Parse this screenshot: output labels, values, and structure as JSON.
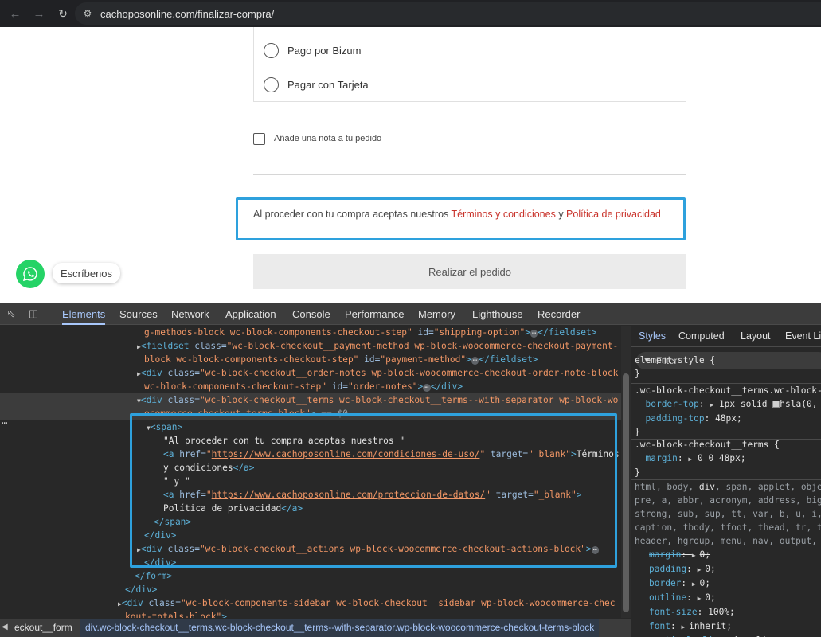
{
  "browser": {
    "url": "cachoposonline.com/finalizar-compra/",
    "back_icon": "arrow-left-icon",
    "forward_icon": "arrow-right-icon",
    "reload_icon": "reload-icon"
  },
  "page": {
    "payment_options": [
      {
        "label": "Pago por Bizum"
      },
      {
        "label": "Pagar con Tarjeta"
      }
    ],
    "note_label": "Añade una nota a tu pedido",
    "terms": {
      "prefix": "Al proceder con tu compra aceptas nuestros ",
      "terms_link": "Términos y condiciones",
      "and": " y ",
      "privacy_link": "Política de privacidad"
    },
    "order_button": "Realizar el pedido",
    "whatsapp_label": "Escríbenos"
  },
  "devtools": {
    "tabs": [
      "Elements",
      "Sources",
      "Network",
      "Application",
      "Console",
      "Performance",
      "Memory",
      "Lighthouse",
      "Recorder"
    ],
    "active_tab": "Elements",
    "dom_lines": {
      "l1": {
        "a": "g-methods-block wc-block-components-checkout-step\"",
        "b": " id=",
        "c": "\"shipping-option\"",
        "d": ">",
        "e": "</fieldset>"
      },
      "l2": {
        "tag": "<fieldset",
        "attr": " class=",
        "val": "\"wc-block-checkout__payment-method wp-block-woocommerce-checkout-payment-"
      },
      "l3": {
        "val": "block wc-block-components-checkout-step\"",
        "attr": " id=",
        "val2": "\"payment-method\"",
        "tag": ">",
        "end": "</fieldset>"
      },
      "l4": {
        "tag": "<div",
        "attr": " class=",
        "val": "\"wc-block-checkout__order-notes wp-block-woocommerce-checkout-order-note-block"
      },
      "l5": {
        "val": "wc-block-components-checkout-step\"",
        "attr": " id=",
        "val2": "\"order-notes\"",
        "tag": ">",
        "end": "</div>"
      },
      "l6": {
        "tag": "<div",
        "attr": " class=",
        "val": "\"wc-block-checkout__terms wc-block-checkout__terms--with-separator wp-block-wo"
      },
      "l7": {
        "val": "ocommerce-checkout-terms-block\"",
        "tag": ">",
        "dim": " == $0"
      },
      "l8": {
        "tag": "<span>"
      },
      "l9": {
        "txt": "\"Al proceder con tu compra aceptas nuestros \""
      },
      "l10": {
        "tag": "<a",
        "attr": " href=",
        "link": "https://www.cachoposonline.com/condiciones-de-uso/",
        "attr2": " target=",
        "val": "\"_blank\"",
        "tag2": ">",
        "txt": "Términos"
      },
      "l11": {
        "txt": "y condiciones",
        "tag": "</a>"
      },
      "l12": {
        "txt": "\" y \""
      },
      "l13": {
        "tag": "<a",
        "attr": " href=",
        "link": "https://www.cachoposonline.com/proteccion-de-datos/",
        "attr2": " target=",
        "val": "\"_blank\"",
        "tag2": ">"
      },
      "l14": {
        "txt": "Política de privacidad",
        "tag": "</a>"
      },
      "l15": {
        "tag": "</span>"
      },
      "l16": {
        "tag": "</div>"
      },
      "l17": {
        "tag": "<div",
        "attr": " class=",
        "val": "\"wc-block-checkout__actions wp-block-woocommerce-checkout-actions-block\"",
        "tag2": ">"
      },
      "l18": {
        "tag": "</div>"
      },
      "l19": {
        "tag": "</form>"
      },
      "l20": {
        "tag": "</div>"
      },
      "l21": {
        "tag": "<div",
        "attr": " class=",
        "val": "\"wc-block-components-sidebar wc-block-checkout__sidebar wp-block-woocommerce-chec"
      },
      "l22": {
        "val": "kout-totals-block\"",
        "tag": ">"
      }
    },
    "breadcrumbs": [
      "eckout__form",
      "div.wc-block-checkout__terms.wc-block-checkout__terms--with-separator.wp-block-woocommerce-checkout-terms-block"
    ],
    "styles": {
      "tabs": [
        "Styles",
        "Computed",
        "Layout",
        "Event Lis"
      ],
      "active_tab": "Styles",
      "filter_placeholder": "Filter",
      "element_style": "element.style {",
      "close": "}",
      "rule1_selector": ".wc-block-checkout__terms.wc-block-",
      "rule1_p1_name": "border-top",
      "rule1_p1_value": "1px solid",
      "rule1_p1_value2": "hsla(0,",
      "rule1_p2_name": "padding-top",
      "rule1_p2_value": "48px;",
      "rule2_selector": ".wc-block-checkout__terms {",
      "rule2_p1_name": "margin",
      "rule2_p1_value": "0 0 48px;",
      "rule3_sel1": "html, body, ",
      "rule3_sel1b": "div",
      "rule3_sel1c": ", span, applet, obje",
      "rule3_sel2": "pre, a, abbr, acronym, address, big",
      "rule3_sel3": "strong, sub, sup, tt, var, b, u, i,",
      "rule3_sel4": "caption, tbody, tfoot, thead, tr, t",
      "rule3_sel5": "header, hgroup, menu, nav, output,",
      "rule3_props": [
        {
          "name": "margin",
          "value": "0;",
          "strike": true
        },
        {
          "name": "padding",
          "value": "0;",
          "strike": false
        },
        {
          "name": "border",
          "value": "0;",
          "strike": false
        },
        {
          "name": "outline",
          "value": "0;",
          "strike": false
        },
        {
          "name": "font-size",
          "value": "100%;",
          "strike": true
        },
        {
          "name": "font",
          "value": "inherit;",
          "strike": false
        },
        {
          "name": "vertical-align",
          "value": "baseline;",
          "strike": false
        }
      ]
    }
  }
}
